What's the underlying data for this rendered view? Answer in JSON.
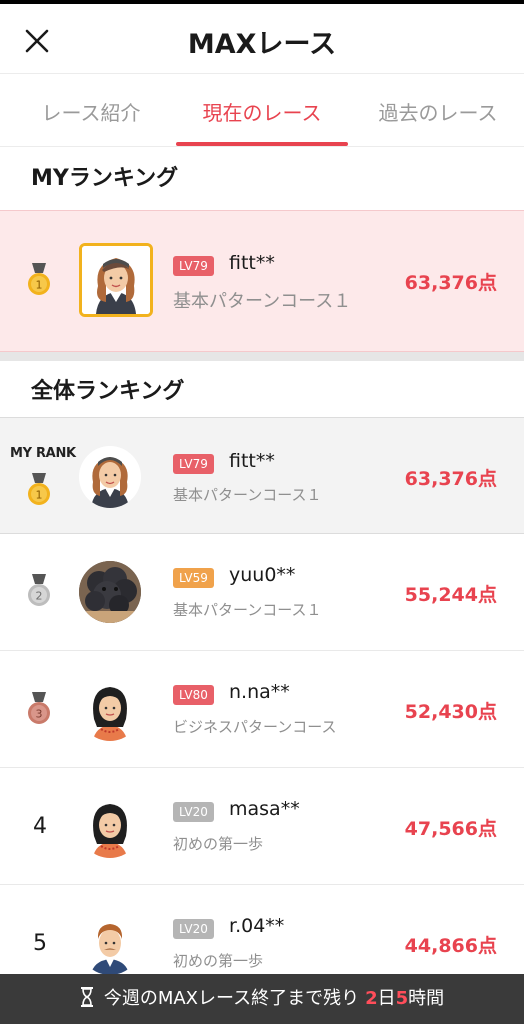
{
  "header": {
    "title": "MAXレース"
  },
  "tabs": [
    {
      "label": "レース紹介"
    },
    {
      "label": "現在のレース"
    },
    {
      "label": "過去のレース"
    }
  ],
  "my_ranking": {
    "section_title": "MYランキング",
    "rank": 1,
    "level": "LV79",
    "name": "fitt**",
    "course": "基本パターンコース１",
    "score": "63,376点"
  },
  "overall_ranking": {
    "section_title": "全体ランキング",
    "my_rank_label": "MY RANK",
    "rows": [
      {
        "rank": "1",
        "level": "LV79",
        "name": "fitt**",
        "course": "基本パターンコース１",
        "score": "63,376点"
      },
      {
        "rank": "2",
        "level": "LV59",
        "name": "yuu0**",
        "course": "基本パターンコース１",
        "score": "55,244点"
      },
      {
        "rank": "3",
        "level": "LV80",
        "name": "n.na**",
        "course": "ビジネスパターンコース",
        "score": "52,430点"
      },
      {
        "rank": "4",
        "level": "LV20",
        "name": "masa**",
        "course": "初めの第一歩",
        "score": "47,566点"
      },
      {
        "rank": "5",
        "level": "LV20",
        "name": "r.04**",
        "course": "初めの第一歩",
        "score": "44,866点"
      }
    ]
  },
  "footer": {
    "text_before": "今週のMAXレース終了まで残り",
    "days": "2",
    "day_unit": "日",
    "hours": "5",
    "hour_unit": "時間"
  },
  "colors": {
    "accent": "#e8434f",
    "gold": "#f2b21d",
    "silver": "#bdbdbd",
    "bronze": "#c97a6a"
  }
}
